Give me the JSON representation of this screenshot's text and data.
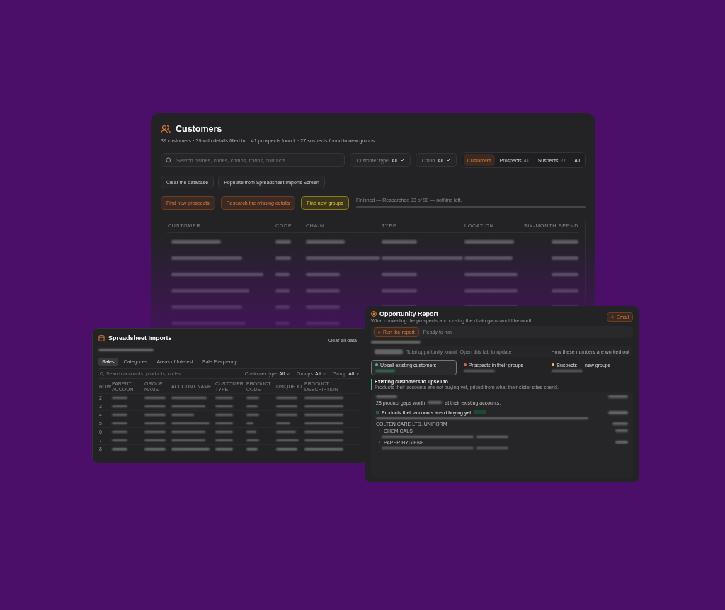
{
  "customers_window": {
    "title": "Customers",
    "summary": "39 customers · 39 with details filled in. · 41 prospects found. · 27 suspects found in new groups.",
    "search": {
      "placeholder": "Search names, codes, chains, towns, contacts…"
    },
    "filters": [
      {
        "label": "Customer type",
        "value": "All"
      },
      {
        "label": "Chain",
        "value": "All"
      }
    ],
    "segments": [
      {
        "label": "Customers",
        "selected": true
      },
      {
        "label": "Prospects",
        "count": "41",
        "selected": false
      },
      {
        "label": "Suspects",
        "count": "27",
        "selected": false
      },
      {
        "label": "All",
        "selected": false
      }
    ],
    "buttons": [
      {
        "label": "Clear the database"
      },
      {
        "label": "Populate from Spreadsheet Imports Screen"
      }
    ],
    "actions": [
      {
        "label": "Find new prospects",
        "kind": "warm"
      },
      {
        "label": "Research the missing details",
        "kind": "warm"
      },
      {
        "label": "Find new groups",
        "kind": "highlight"
      }
    ],
    "status": {
      "text": "Finished — Researched 93 of 93 — nothing left.",
      "level": 1
    },
    "table": {
      "columns": [
        "CUSTOMER",
        "CODE",
        "CHAIN",
        "TYPE",
        "LOCATION",
        "SIX-MONTH SPEND"
      ]
    }
  },
  "imports_window": {
    "title": "Spreadsheet Imports",
    "clear_button": "Clear all data",
    "tabs": [
      {
        "label": "Sales",
        "selected": true
      },
      {
        "label": "Categories",
        "selected": false
      },
      {
        "label": "Areas of Interest",
        "selected": false
      },
      {
        "label": "Sale Frequency",
        "selected": false
      }
    ],
    "search": {
      "placeholder": "Search accounts, products, codes…"
    },
    "filters": [
      {
        "label": "Customer type",
        "value": "All"
      },
      {
        "label": "Groups",
        "value": "All"
      },
      {
        "label": "Group",
        "value": "All"
      }
    ],
    "table": {
      "columns": [
        "ROW",
        "PARENT ACCOUNT",
        "GROUP NAME",
        "ACCOUNT NAME",
        "CUSTOMER TYPE",
        "PRODUCT CODE",
        "UNIQUE ID",
        "PRODUCT DESCRIPTION"
      ],
      "rows": [
        "2",
        "3",
        "4",
        "5",
        "6",
        "7",
        "8"
      ]
    }
  },
  "opportunity_window": {
    "title": "Opportunity Report",
    "subtitle": "What converting the prospects and closing the chain gaps would be worth.",
    "email_button": "Email",
    "run_button": "Run the report",
    "run_status": "Ready to run",
    "total_label": "Total opportunity found",
    "total_note": "Open this tab to update",
    "method_link": "How these numbers are worked out",
    "cards": [
      {
        "label": "Upsell existing customers",
        "color": "#3fbf7f",
        "selected": true
      },
      {
        "label": "Prospects in their groups",
        "color": "#e0604a",
        "selected": false
      },
      {
        "label": "Suspects — new groups",
        "color": "#e8c53a",
        "selected": false
      }
    ],
    "section": {
      "title": "Existing customers to upsell to",
      "subtitle": "Products their accounts are not buying yet, priced from what their sister sites spend.",
      "gaps_before": "28 product gaps worth",
      "gaps_after": "at their existing accounts.",
      "products_heading": "Products their accounts aren't buying yet",
      "account": "COLTEN CARE LTD. UNIFORM",
      "categories": [
        {
          "label": "CHEMICALS",
          "expanded": false
        },
        {
          "label": "PAPER HYGIENE",
          "expanded": false
        }
      ]
    }
  }
}
